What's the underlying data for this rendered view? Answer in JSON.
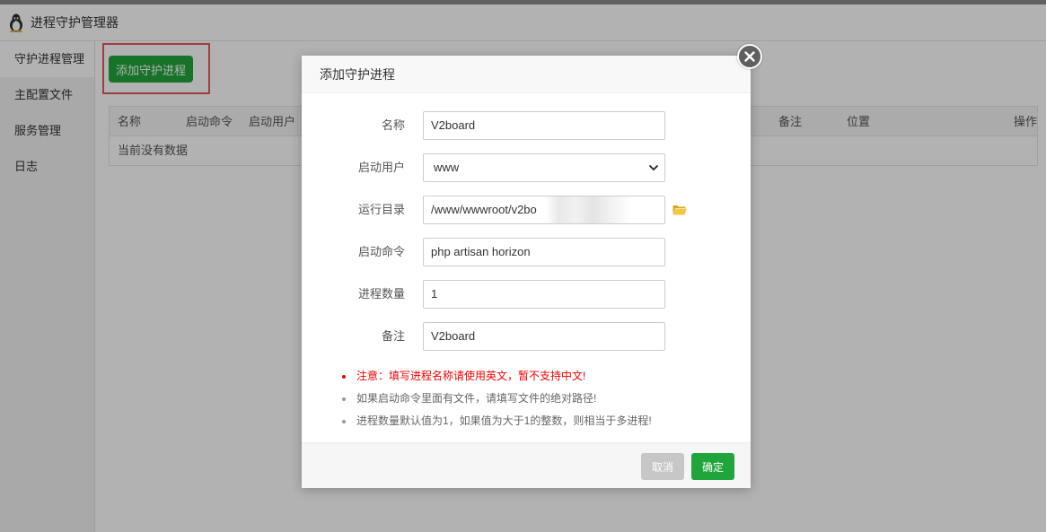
{
  "app": {
    "title": "进程守护管理器"
  },
  "sidebar": {
    "items": [
      {
        "label": "守护进程管理"
      },
      {
        "label": "主配置文件"
      },
      {
        "label": "服务管理"
      },
      {
        "label": "日志"
      }
    ]
  },
  "toolbar": {
    "add_label": "添加守护进程"
  },
  "table": {
    "headers": [
      "名称",
      "启动命令",
      "启动用户",
      "备注",
      "位置",
      "操作"
    ],
    "empty_text": "当前没有数据"
  },
  "modal": {
    "title": "添加守护进程",
    "fields": {
      "name": {
        "label": "名称",
        "value": "V2board"
      },
      "user": {
        "label": "启动用户",
        "value": "www"
      },
      "dir": {
        "label": "运行目录",
        "value": "/www/wwwroot/v2bo"
      },
      "command": {
        "label": "启动命令",
        "value": "php artisan horizon"
      },
      "count": {
        "label": "进程数量",
        "value": "1"
      },
      "remark": {
        "label": "备注",
        "value": "V2board"
      }
    },
    "notes": [
      "注意：填写进程名称请使用英文，暂不支持中文!",
      "如果启动命令里面有文件，请填写文件的绝对路径!",
      "进程数量默认值为1，如果值为大于1的整数，则相当于多进程!"
    ],
    "cancel_label": "取消",
    "ok_label": "确定"
  },
  "colors": {
    "accent": "#20a53a",
    "warning": "#e00000",
    "highlight_border": "#e35a5a"
  },
  "icons": [
    "tux-logo-icon",
    "close-icon",
    "folder-icon",
    "chevron-down-icon"
  ]
}
